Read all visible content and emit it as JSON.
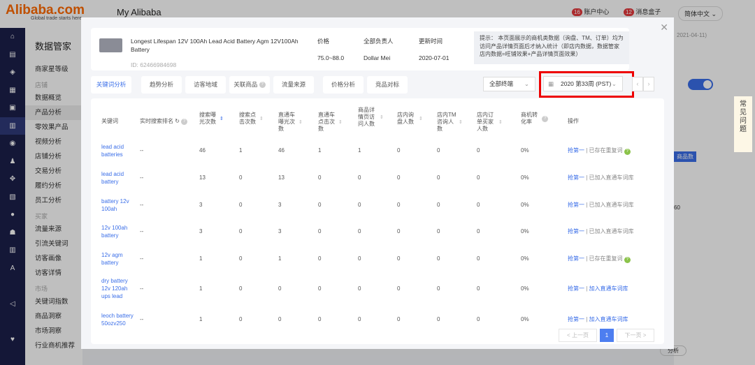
{
  "header": {
    "logo": "Alibaba.com",
    "slogan": "Global trade starts here",
    "title": "My Alibaba",
    "account_badge": "16",
    "account": "账户中心",
    "msg_badge": "12",
    "messages": "消息盒子",
    "lang": "简体中文 ⌄"
  },
  "sidebar_icons": [
    "⌂",
    "▤",
    "◈",
    "▦",
    "▣",
    "▥",
    "◉",
    "♟",
    "✥",
    "▧",
    "●",
    "☗",
    "▥",
    "A",
    "",
    "◁",
    "",
    "♥"
  ],
  "submenu": {
    "title": "数据管家",
    "items": [
      {
        "t": "i",
        "l": "商家星等级"
      },
      {
        "t": "g",
        "l": "店铺"
      },
      {
        "t": "i",
        "l": "数据概览"
      },
      {
        "t": "i",
        "l": "产品分析",
        "sel": true
      },
      {
        "t": "i",
        "l": "零效果产品"
      },
      {
        "t": "i",
        "l": "视频分析"
      },
      {
        "t": "i",
        "l": "店铺分析"
      },
      {
        "t": "i",
        "l": "交易分析"
      },
      {
        "t": "i",
        "l": "履约分析"
      },
      {
        "t": "i",
        "l": "员工分析"
      },
      {
        "t": "g",
        "l": "买家"
      },
      {
        "t": "i",
        "l": "流量来源"
      },
      {
        "t": "i",
        "l": "引流关键词"
      },
      {
        "t": "i",
        "l": "访客画像"
      },
      {
        "t": "i",
        "l": "访客详情"
      },
      {
        "t": "g",
        "l": "市场"
      },
      {
        "t": "i",
        "l": "关键词指数"
      },
      {
        "t": "i",
        "l": "商品洞察"
      },
      {
        "t": "i",
        "l": "市场洞察"
      },
      {
        "t": "i",
        "l": "行业商机推荐"
      }
    ]
  },
  "faq": "常见问题",
  "product": {
    "name": "Longest Lifespan 12V 100Ah Lead Acid Battery Agm 12V100Ah Battery",
    "id": "ID: 62466984698",
    "price_label": "价格",
    "price": "75.0~88.0",
    "owner_label": "全部负责人",
    "owner": "Dollar Mei",
    "updated_label": "更新时间",
    "updated": "2020-07-01",
    "tip": "提示： 本页面展示的商机类数据（询盘、TM、订单）均为访问产品详情页面后才纳入统计（即店内数据，数据管家店内数据=旺铺效果+产品详情页面效果）"
  },
  "tabs": [
    "关键词分析",
    "趋势分析",
    "访客地域",
    "关联商品",
    "流量来源",
    "价格分析",
    "竞品对标"
  ],
  "terminal": "全部终端",
  "week": "2020 第33周 (PST)",
  "columns": [
    "关键词",
    "实时搜索排名",
    "搜索曝光次数",
    "搜索点击次数",
    "直通车曝光次数",
    "直通车点击次数",
    "商品详情页访问人数",
    "店内询盘人数",
    "店内TM咨询人数",
    "店内订单买家人数",
    "商机转化率",
    "操作"
  ],
  "rows": [
    {
      "kw": "lead acid batteries",
      "rank": "--",
      "v": [
        "46",
        "1",
        "46",
        "1",
        "1",
        "0",
        "0",
        "0",
        "0%"
      ],
      "a": "抢第一",
      "s": "已存在重复词",
      "link": false,
      "q": true
    },
    {
      "kw": "lead acid battery",
      "rank": "--",
      "v": [
        "13",
        "0",
        "13",
        "0",
        "0",
        "0",
        "0",
        "0",
        "0%"
      ],
      "a": "抢第一",
      "s": "已加入直通车词库",
      "link": false,
      "q": false
    },
    {
      "kw": "battery 12v 100ah",
      "rank": "--",
      "v": [
        "3",
        "0",
        "3",
        "0",
        "0",
        "0",
        "0",
        "0",
        "0%"
      ],
      "a": "抢第一",
      "s": "已加入直通车词库",
      "link": false,
      "q": false
    },
    {
      "kw": "12v 100ah battery",
      "rank": "--",
      "v": [
        "3",
        "0",
        "3",
        "0",
        "0",
        "0",
        "0",
        "0",
        "0%"
      ],
      "a": "抢第一",
      "s": "已加入直通车词库",
      "link": false,
      "q": false
    },
    {
      "kw": "12v agm battery",
      "rank": "--",
      "v": [
        "1",
        "0",
        "1",
        "0",
        "0",
        "0",
        "0",
        "0",
        "0%"
      ],
      "a": "抢第一",
      "s": "已存在重复词",
      "link": false,
      "q": true
    },
    {
      "kw": "dry battery 12v 120ah ups lead",
      "rank": "--",
      "v": [
        "1",
        "0",
        "0",
        "0",
        "0",
        "0",
        "0",
        "0",
        "0%"
      ],
      "a": "抢第一",
      "s": "加入直通车词库",
      "link": true,
      "q": false
    },
    {
      "kw": "leoch battery 50ozv250",
      "rank": "--",
      "v": [
        "1",
        "0",
        "0",
        "0",
        "0",
        "0",
        "0",
        "0",
        "0%"
      ],
      "a": "抢第一",
      "s": "加入直通车词库",
      "link": true,
      "q": false
    }
  ],
  "pagination": {
    "prev": "< 上一页",
    "page": "1",
    "next": "下一页 >"
  },
  "bg": {
    "date": "2021-04-11)",
    "tag": "商品数",
    "num": "60",
    "btn": "分析"
  }
}
